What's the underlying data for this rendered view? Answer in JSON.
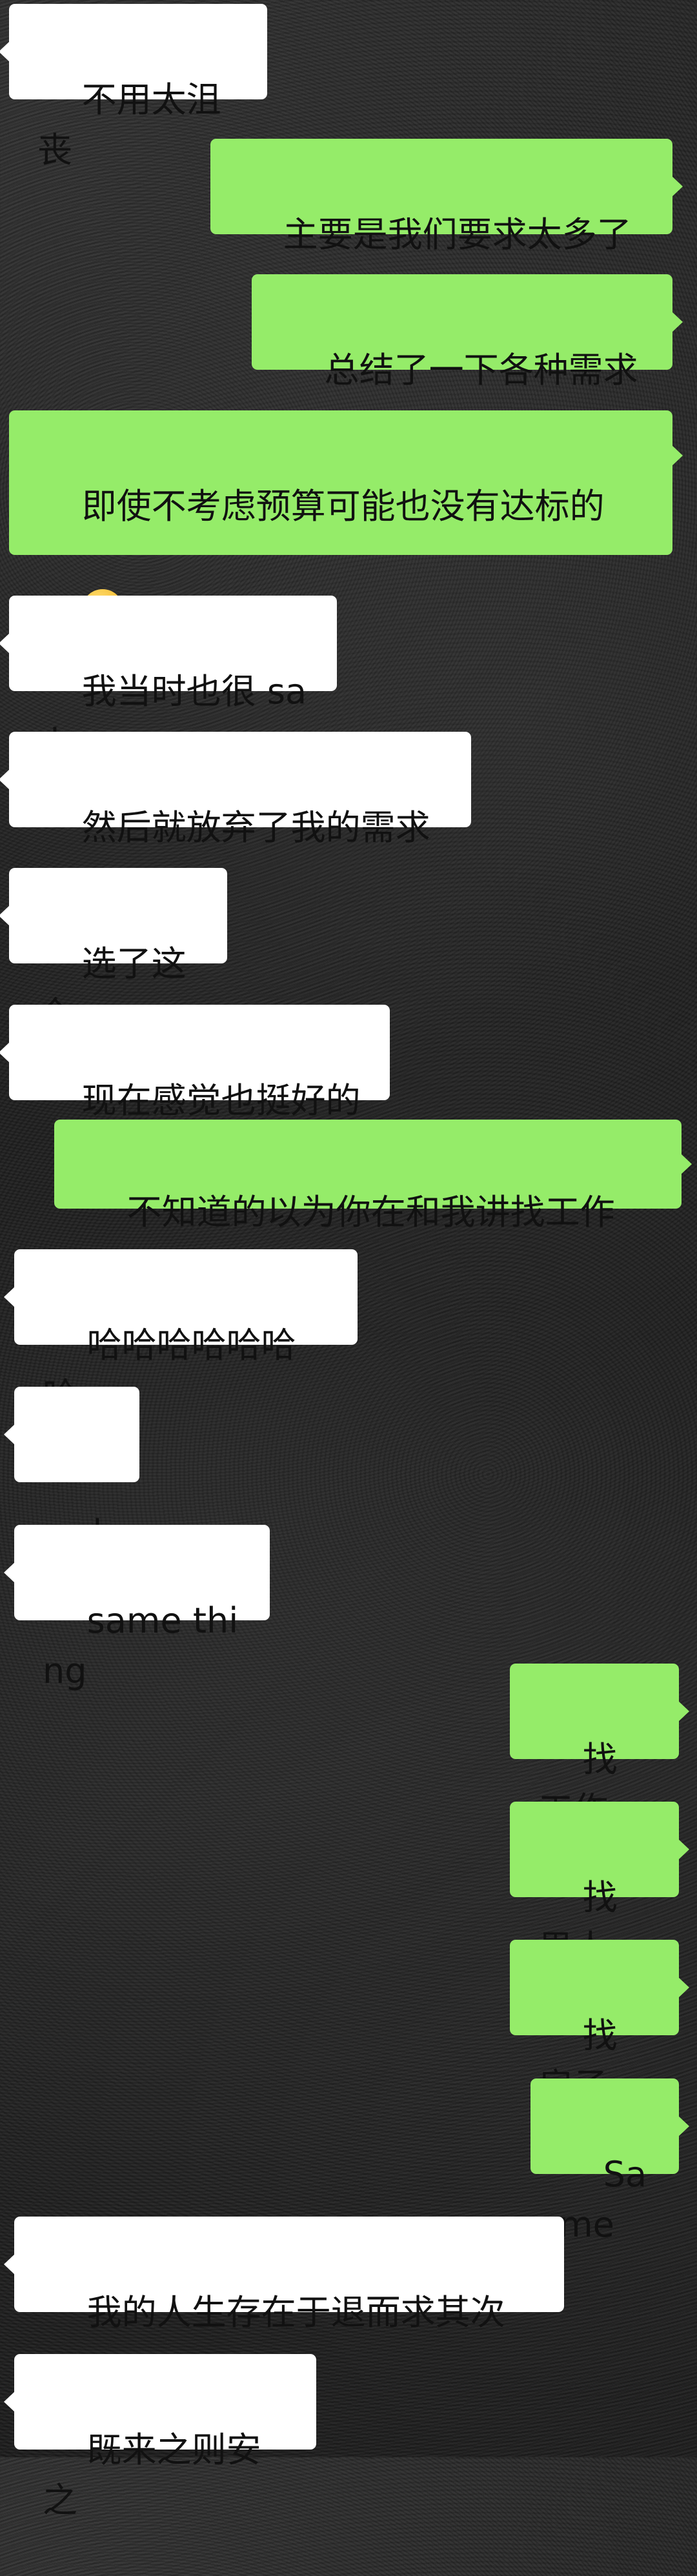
{
  "messages": [
    {
      "side": "in",
      "text": "不用太沮丧"
    },
    {
      "side": "out",
      "text": "主要是我们要求太多了"
    },
    {
      "side": "out",
      "text": "总结了一下各种需求"
    },
    {
      "side": "out",
      "text": "即使不考虑预算可能也没有达标的",
      "emoji": "grinning-face-emoji"
    },
    {
      "side": "in",
      "text": "我当时也很 sad"
    },
    {
      "side": "in",
      "text": "然后就放弃了我的需求"
    },
    {
      "side": "in",
      "text": "选了这个"
    },
    {
      "side": "in",
      "text": "现在感觉也挺好的"
    },
    {
      "side": "out",
      "text": "不知道的以为你在和我讲找工作"
    },
    {
      "side": "in",
      "text": "哈哈哈哈哈哈哈"
    },
    {
      "side": "in",
      "text": "well"
    },
    {
      "side": "in",
      "text": "same thing"
    },
    {
      "side": "out",
      "text": "找工作"
    },
    {
      "side": "out",
      "text": "找男人"
    },
    {
      "side": "out",
      "text": "找房子"
    },
    {
      "side": "out",
      "text": "Same"
    },
    {
      "side": "in",
      "text": "我的人生存在于退而求其次"
    },
    {
      "side": "in",
      "text": "既来之则安之"
    }
  ],
  "colors": {
    "incoming_bubble": "#ffffff",
    "outgoing_bubble": "#95ec69",
    "text": "#111111",
    "background": "#1f1f1f"
  }
}
